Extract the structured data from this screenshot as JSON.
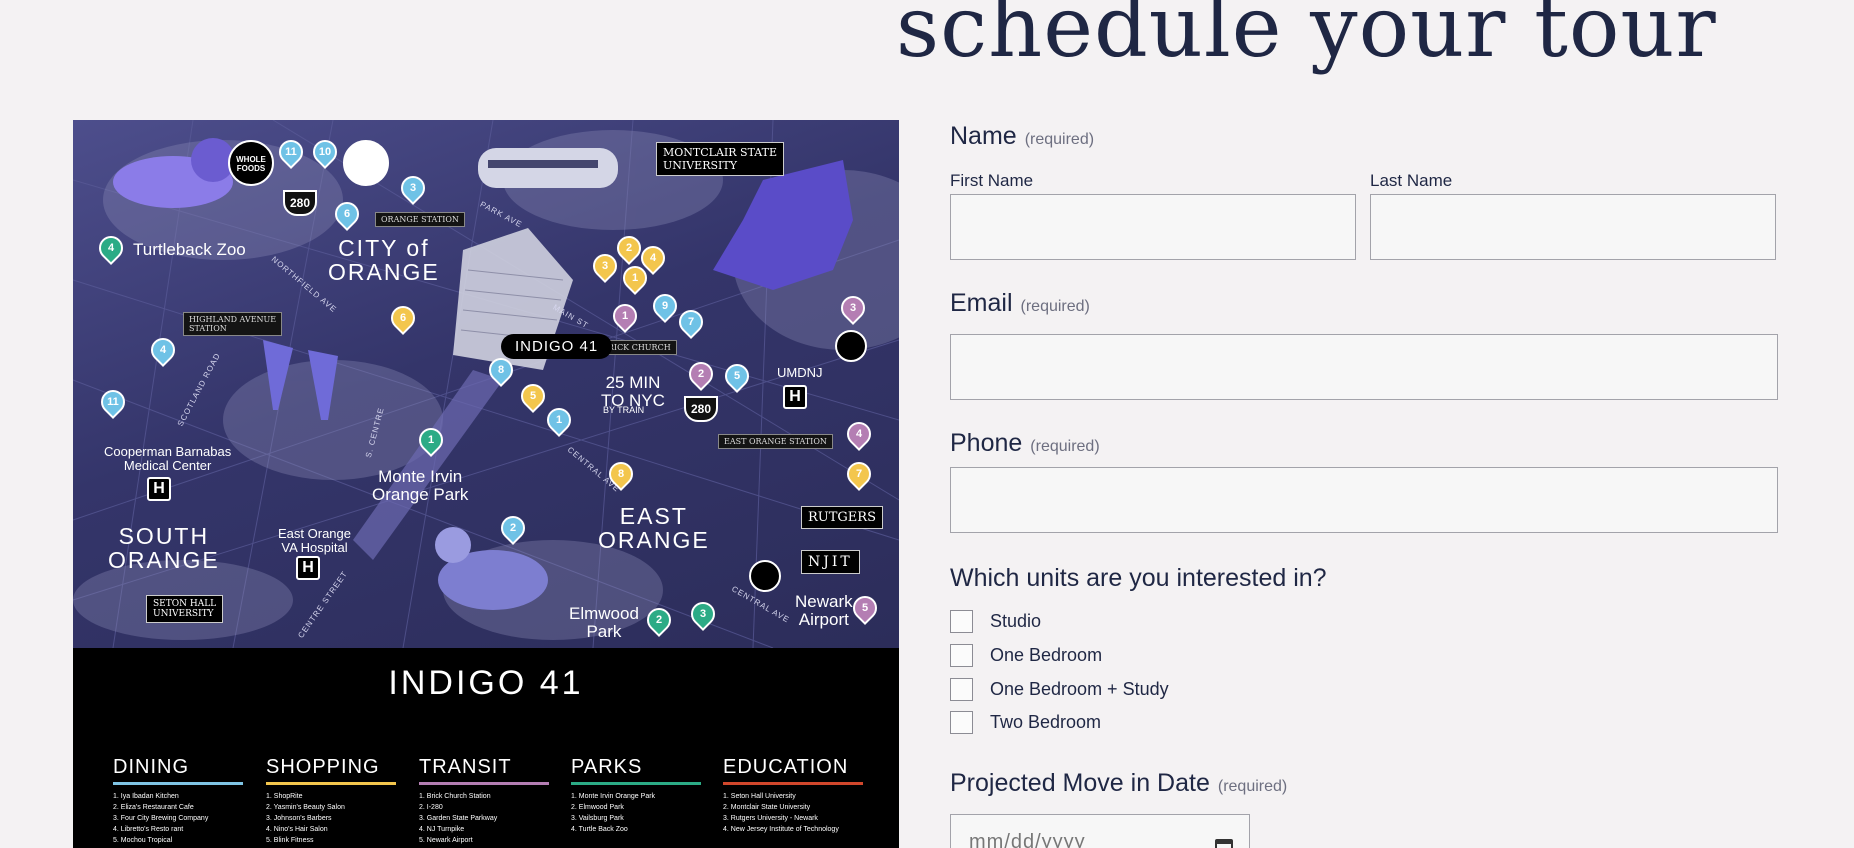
{
  "page": {
    "title": "schedule your tour"
  },
  "map": {
    "brand": "INDIGO 41",
    "areas": {
      "city_of_orange": "CITY of\nORANGE",
      "east_orange": "EAST\nORANGE",
      "south_orange": "SOUTH\nORANGE"
    },
    "places": {
      "turtleback": "Turtleback Zoo",
      "cooperman": "Cooperman Barnabas\nMedical Center",
      "va_hospital": "East Orange\nVA Hospital",
      "monte_irvin": "Monte Irvin\nOrange Park",
      "elmwood": "Elmwood\nPark",
      "newark_airport": "Newark\nAirport",
      "umdnj": "UMDNJ",
      "nyc": "25 MIN\nTO NYC",
      "nyc_sub": "BY TRAIN"
    },
    "stations": {
      "orange": "ORANGE STATION",
      "highland": "HIGHLAND AVENUE\nSTATION",
      "brick_church": "BRICK CHURCH",
      "east_orange": "EAST ORANGE STATION"
    },
    "roads": {
      "park_ave": "PARK AVE",
      "northfield": "NORTHFIELD AVE",
      "main_st": "MAIN ST",
      "scotland": "SCOTLAND ROAD",
      "s_centre": "S. CENTRE",
      "central_ave": "CENTRAL AVE",
      "centre_street": "CENTRE STREET",
      "central_ave_2": "CENTRAL AVE"
    },
    "badges": {
      "montclair": "MONTCLAIR STATE\nUNIVERSITY",
      "rutgers": "RUTGERS",
      "njit": "NJIT",
      "seton_hall": "SETON HALL\nUNIVERSITY",
      "whole_foods": "WHOLE\nFOODS",
      "hwy_280": "280",
      "hospital": "H"
    },
    "pins": {
      "blue": [
        "11",
        "10",
        "3",
        "6",
        "9",
        "7",
        "8",
        "1",
        "5",
        "2",
        "4",
        "11"
      ],
      "yellow": [
        "3",
        "2",
        "4",
        "1",
        "6",
        "5",
        "8",
        "7"
      ],
      "purple": [
        "1",
        "2",
        "3",
        "4",
        "5"
      ],
      "green": [
        "4",
        "1",
        "2",
        "3"
      ]
    }
  },
  "legend": {
    "logo": "INDIGO 41",
    "columns": [
      {
        "title": "DINING",
        "color": "#7fc4e4",
        "items": [
          "1.  Iya Ibadan Kitchen",
          "2.  Eliza's Restaurant Cafe",
          "3.  Four City Brewing Company",
          "4.  Libretto's Resto  rant",
          "5.  Mochou Tropical"
        ]
      },
      {
        "title": "SHOPPING",
        "color": "#f3c64d",
        "items": [
          "1.  ShopRite",
          "2.  Yasmin's Beauty Salon",
          "3.  Johnson's Barbers",
          "4.  Nino's Hair Salon",
          "5.  Blink Fitness"
        ]
      },
      {
        "title": "TRANSIT",
        "color": "#b47eb3",
        "items": [
          "1.  Brick Church Station",
          "2.  I-280",
          "3.  Garden State Parkway",
          "4.  NJ Turnpike",
          "5.  Newark Airport"
        ]
      },
      {
        "title": "PARKS",
        "color": "#2cab86",
        "items": [
          "1.  Monte Irvin Orange Park",
          "2.  Elmwood Park",
          "3.  Vailsburg Park",
          "4.  Turtle Back Zoo"
        ]
      },
      {
        "title": "EDUCATION",
        "color": "#d0472c",
        "items": [
          "1.  Seton Hall University",
          "2.  Montclair State University",
          "3.  Rutgers University - Newark",
          "4.  New Jersey Institute of Technology"
        ]
      }
    ]
  },
  "form": {
    "name": {
      "label": "Name",
      "required": "(required)",
      "first_label": "First Name",
      "last_label": "Last Name",
      "first_value": "",
      "last_value": ""
    },
    "email": {
      "label": "Email",
      "required": "(required)",
      "value": ""
    },
    "phone": {
      "label": "Phone",
      "required": "(required)",
      "value": ""
    },
    "units": {
      "label": "Which units are you interested in?",
      "options": [
        "Studio",
        "One Bedroom",
        "One Bedroom + Study",
        "Two Bedroom"
      ]
    },
    "move_date": {
      "label": "Projected Move in Date",
      "required": "(required)",
      "placeholder": "mm/dd/yyyy"
    }
  }
}
